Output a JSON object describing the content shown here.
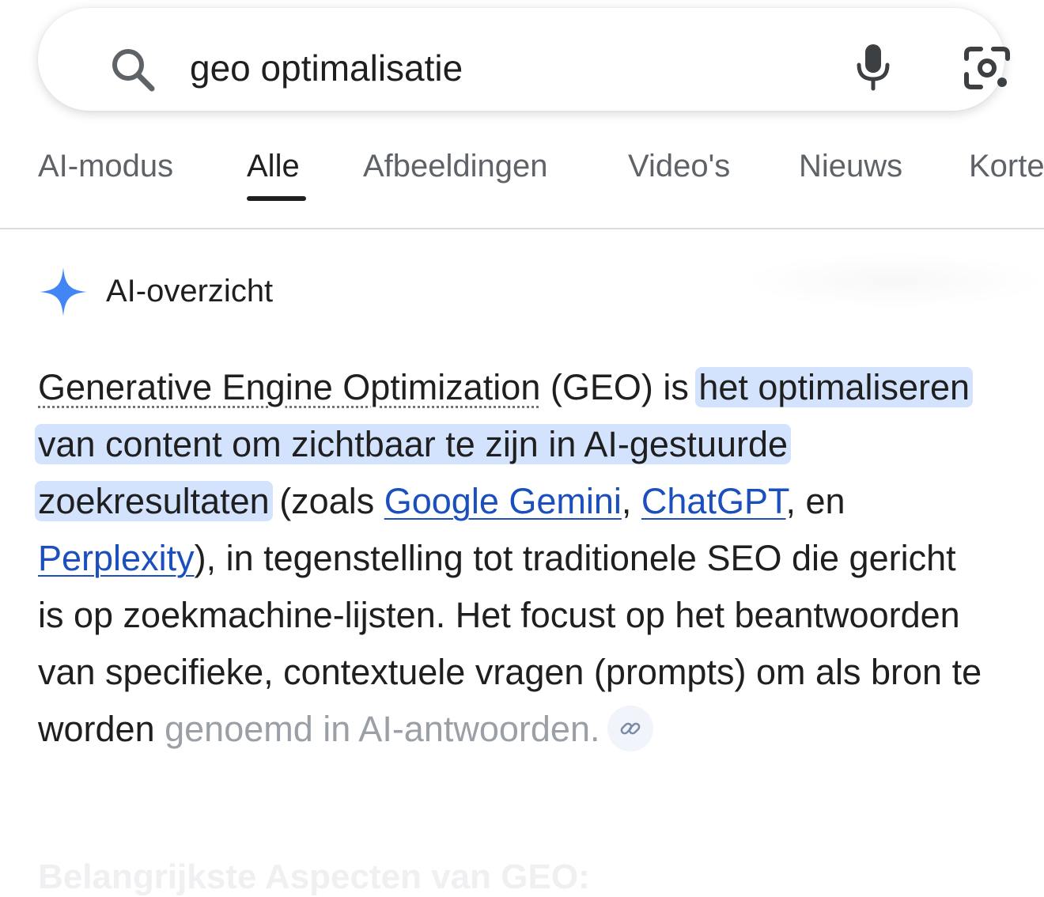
{
  "search": {
    "query": "geo optimalisatie",
    "icons": {
      "search": "search-icon",
      "mic": "mic-icon",
      "lens": "google-lens-icon"
    }
  },
  "tabs": [
    {
      "label": "AI-modus",
      "active": false
    },
    {
      "label": "Alle",
      "active": true
    },
    {
      "label": "Afbeeldingen",
      "active": false
    },
    {
      "label": "Video's",
      "active": false
    },
    {
      "label": "Nieuws",
      "active": false
    },
    {
      "label": "Korte",
      "active": false
    }
  ],
  "ai_overview": {
    "title": "AI-overzicht",
    "icon": "sparkle-icon",
    "accent_color": "#4285f4",
    "highlight_color": "#d3e3fd",
    "link_color": "#1a4fbd",
    "paragraph": {
      "term": "Generative Engine Optimization",
      "after_term": " (GEO) is ",
      "highlight": "het optimaliseren van content om zichtbaar te zijn in AI-gestuurde zoekresultaten",
      "before_links": " (zoals ",
      "link1": "Google Gemini",
      "sep1": ", ",
      "link2": "ChatGPT",
      "sep2": ", en ",
      "link3": "Perplexity",
      "after_links": "), in tegenstelling tot traditionele SEO die gericht is op zoekmachine-lijsten. Het focust op het beantwoorden van specifieke, contextuele vragen (prompts) om als bron te worden",
      "faded_end": "genoemd in AI-antwoorden.",
      "cite_icon": "link-icon"
    },
    "next_heading": "Belangrijkste Aspecten van GEO:"
  }
}
